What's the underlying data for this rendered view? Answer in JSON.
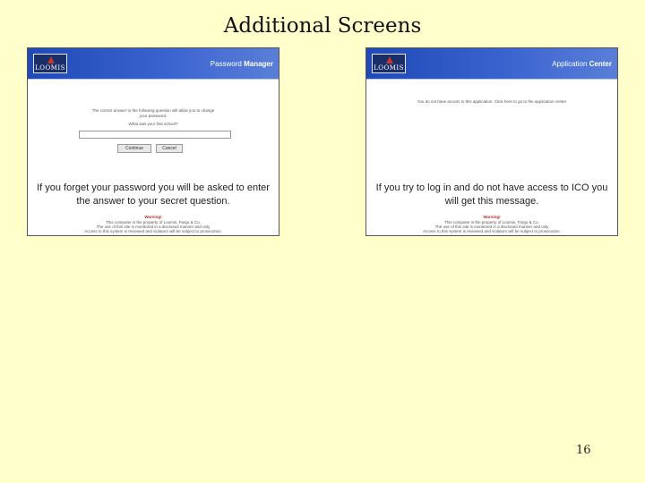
{
  "slide": {
    "title": "Additional Screens",
    "page_number": "16"
  },
  "screens": [
    {
      "logo_text": "LOOMIS",
      "app_title_light": "Password",
      "app_title_bold": "Manager",
      "instruction_line1": "The correct answer to the following question will allow you to change",
      "instruction_line2": "your password.",
      "question": "What was your first school?",
      "continue_label": "Continue",
      "cancel_label": "Cancel",
      "caption": "If you forget your password you will be asked to enter the answer to your secret question.",
      "warning_title": "Warning!",
      "footer_line1": "This computer is the property of Loomis, Fargo & Co.",
      "footer_line2": "The use of this site is monitored in a disclosed manner and only",
      "footer_line3": "Access to this system is reviewed and violators will be subject to prosecution."
    },
    {
      "logo_text": "LOOMIS",
      "app_title_light": "Application",
      "app_title_bold": "Center",
      "message": "You do not have access to this application. Click here to go to the application center",
      "caption": "If you try to log in and do not have access to ICO you will get this message.",
      "warning_title": "Warning!",
      "footer_line1": "This computer is the property of Loomis, Fargo & Co.",
      "footer_line2": "The use of this site is monitored in a disclosed manner and only",
      "footer_line3": "Access to this system is reviewed and violators will be subject to prosecution."
    }
  ]
}
